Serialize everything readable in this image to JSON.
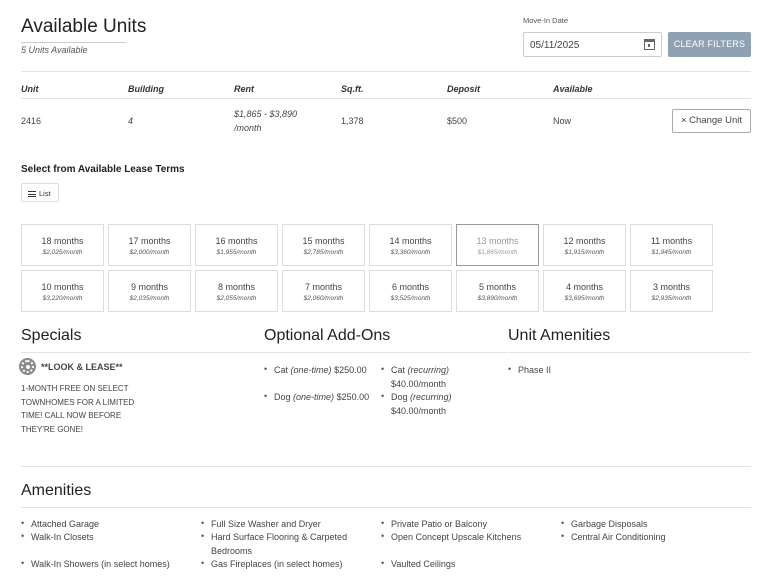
{
  "header": {
    "title": "Available Units",
    "subtitle": "5 Units Available",
    "move_in_label": "Move-In Date",
    "move_in_value": "05/11/2025",
    "clear_filters_label": "CLEAR FILTERS"
  },
  "unit_table": {
    "columns": [
      "Unit",
      "Building",
      "Rent",
      "Sq.ft.",
      "Deposit",
      "Available"
    ],
    "row": {
      "unit": "2416",
      "building": "4",
      "rent_line1": "$1,865 - $3,890",
      "rent_line2": "/month",
      "sqft": "1,378",
      "deposit": "$500",
      "available": "Now"
    },
    "change_unit_label": "× Change Unit"
  },
  "lease_terms": {
    "heading": "Select from Available Lease Terms",
    "list_label": "List",
    "terms": [
      {
        "months": "18 months",
        "price": "$2,025/month"
      },
      {
        "months": "17 months",
        "price": "$2,000/month"
      },
      {
        "months": "16 months",
        "price": "$1,955/month"
      },
      {
        "months": "15 months",
        "price": "$2,785/month"
      },
      {
        "months": "14 months",
        "price": "$3,360/month"
      },
      {
        "months": "13 months",
        "price": "$1,865/month"
      },
      {
        "months": "12 months",
        "price": "$1,915/month"
      },
      {
        "months": "11 months",
        "price": "$1,945/month"
      },
      {
        "months": "10 months",
        "price": "$3,220/month"
      },
      {
        "months": "9 months",
        "price": "$2,035/month"
      },
      {
        "months": "8 months",
        "price": "$2,055/month"
      },
      {
        "months": "7 months",
        "price": "$2,060/month"
      },
      {
        "months": "6 months",
        "price": "$3,525/month"
      },
      {
        "months": "5 months",
        "price": "$3,890/month"
      },
      {
        "months": "4 months",
        "price": "$3,695/month"
      },
      {
        "months": "3 months",
        "price": "$2,935/month"
      }
    ],
    "selected_term": "13 months"
  },
  "specials": {
    "title": "Specials",
    "name": "**LOOK & LEASE**",
    "description": "1-MONTH FREE ON SELECT TOWNHOMES FOR A LIMITED TIME! CALL NOW BEFORE THEY'RE GONE!"
  },
  "addons": {
    "title": "Optional Add-Ons",
    "items": [
      {
        "name": "Cat",
        "type": "(one-time)",
        "price": "$250.00"
      },
      {
        "name": "Dog",
        "type": "(one-time)",
        "price": "$250.00"
      },
      {
        "name": "Cat",
        "type": "(recurring)",
        "price": "$40.00/month"
      },
      {
        "name": "Dog",
        "type": "(recurring)",
        "price": "$40.00/month"
      }
    ]
  },
  "unit_amenities": {
    "title": "Unit Amenities",
    "items": [
      "Phase II"
    ]
  },
  "amenities": {
    "title": "Amenities",
    "col1": [
      "Attached Garage",
      "Walk-In Closets",
      "Walk-In Showers (in select homes)"
    ],
    "col2": [
      "Full Size Washer and Dryer",
      "Hard Surface Flooring & Carpeted Bedrooms",
      "Gas Fireplaces (in select homes)"
    ],
    "col3": [
      "Private Patio or Balcony",
      "Open Concept Upscale Kitchens",
      "Vaulted Ceilings"
    ],
    "col4": [
      "Garbage Disposals",
      "Central Air Conditioning"
    ]
  }
}
